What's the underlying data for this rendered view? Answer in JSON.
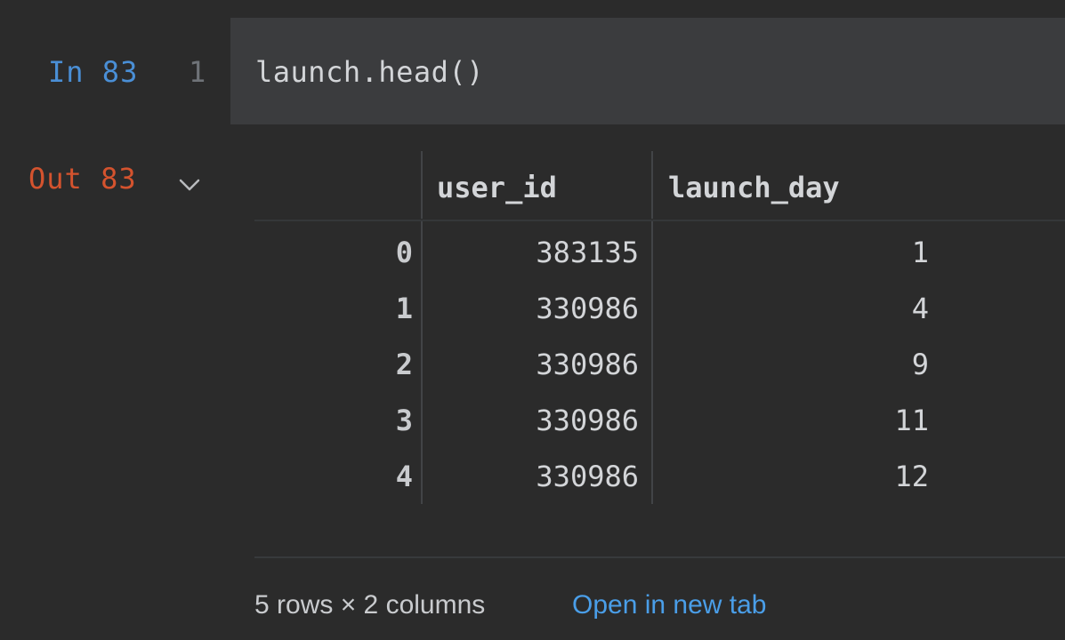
{
  "cell": {
    "in_label": "In 83",
    "line_number": "1",
    "code": "launch.head()",
    "out_label": "Out 83"
  },
  "table": {
    "columns": [
      "user_id",
      "launch_day"
    ],
    "rows": [
      {
        "index": "0",
        "user_id": "383135",
        "launch_day": "1"
      },
      {
        "index": "1",
        "user_id": "330986",
        "launch_day": "4"
      },
      {
        "index": "2",
        "user_id": "330986",
        "launch_day": "9"
      },
      {
        "index": "3",
        "user_id": "330986",
        "launch_day": "11"
      },
      {
        "index": "4",
        "user_id": "330986",
        "launch_day": "12"
      }
    ]
  },
  "footer": {
    "summary": "5 rows × 2 columns",
    "open_link": "Open in new tab"
  },
  "colors": {
    "in_label": "#4a8fd6",
    "out_label": "#d4532e",
    "link": "#4a9ee8",
    "background": "#2b2b2b",
    "code_background": "#3b3c3e"
  },
  "icons": {
    "collapse": "chevron-down-icon"
  }
}
